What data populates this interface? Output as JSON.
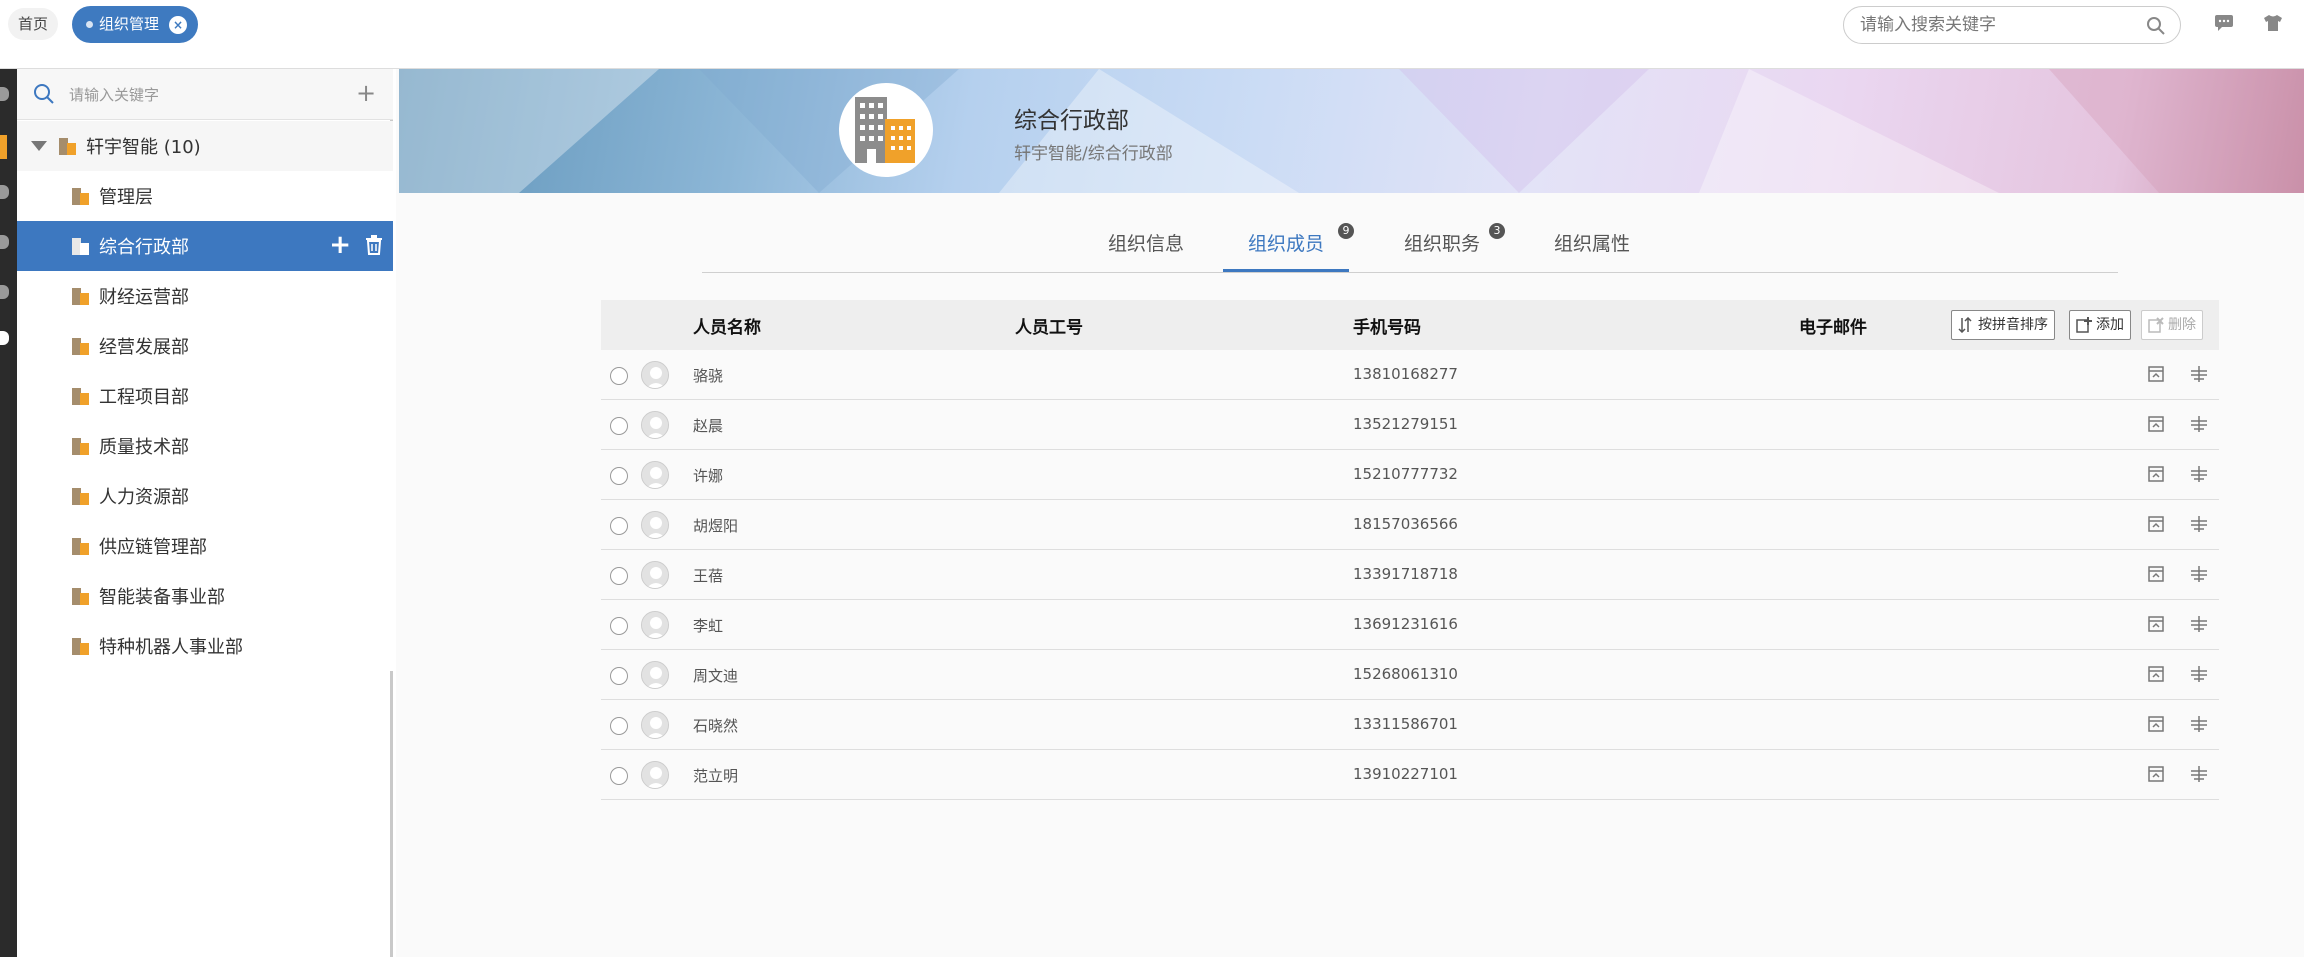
{
  "topbar": {
    "home_tab": "首页",
    "active_tab": "组织管理",
    "search_placeholder": "请输入搜索关键字"
  },
  "sidebar": {
    "search_placeholder": "请输入关键字",
    "root": "轩宇智能 (10)",
    "items": [
      {
        "label": "管理层"
      },
      {
        "label": "综合行政部",
        "selected": true
      },
      {
        "label": "财经运营部"
      },
      {
        "label": "经营发展部"
      },
      {
        "label": "工程项目部"
      },
      {
        "label": "质量技术部"
      },
      {
        "label": "人力资源部"
      },
      {
        "label": "供应链管理部"
      },
      {
        "label": "智能装备事业部"
      },
      {
        "label": "特种机器人事业部"
      }
    ]
  },
  "banner": {
    "title": "综合行政部",
    "subtitle": "轩宇智能/综合行政部"
  },
  "tabs": [
    {
      "label": "组织信息",
      "badge": null
    },
    {
      "label": "组织成员",
      "badge": "9",
      "active": true
    },
    {
      "label": "组织职务",
      "badge": "3"
    },
    {
      "label": "组织属性",
      "badge": null
    }
  ],
  "table": {
    "headers": {
      "name": "人员名称",
      "id": "人员工号",
      "phone": "手机号码",
      "email": "电子邮件"
    },
    "buttons": {
      "sort": "按拼音排序",
      "add": "添加",
      "delete": "删除"
    },
    "rows": [
      {
        "name": "骆骁",
        "phone": "13810168277"
      },
      {
        "name": "赵晨",
        "phone": "13521279151"
      },
      {
        "name": "许娜",
        "phone": "15210777732"
      },
      {
        "name": "胡煜阳",
        "phone": "18157036566"
      },
      {
        "name": "王蓓",
        "phone": "13391718718"
      },
      {
        "name": "李虹",
        "phone": "13691231616"
      },
      {
        "name": "周文迪",
        "phone": "15268061310"
      },
      {
        "name": "石晓然",
        "phone": "13311586701"
      },
      {
        "name": "范立明",
        "phone": "13910227101"
      }
    ]
  },
  "colors": {
    "accent": "#3d78c0",
    "building": "#f0a12a"
  }
}
